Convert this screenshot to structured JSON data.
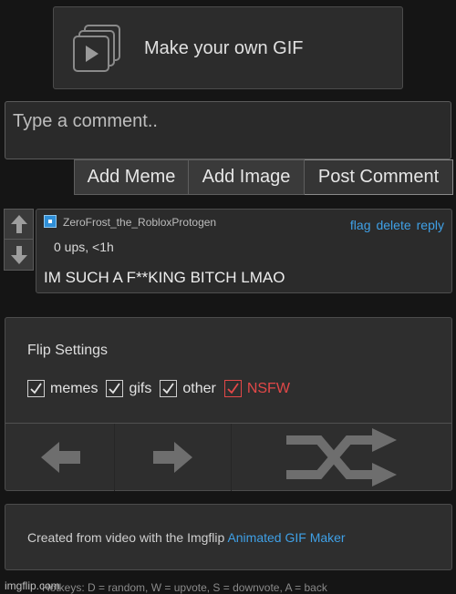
{
  "gif_button": {
    "label": "Make your own GIF",
    "icon": "gif-frames-icon"
  },
  "comment_input": {
    "placeholder": "Type a comment..",
    "value": ""
  },
  "buttons": {
    "add_meme": "Add Meme",
    "add_image": "Add Image",
    "post_comment": "Post Comment"
  },
  "comment": {
    "username": "ZeroFrost_the_RobloxProtogen",
    "avatar_color": "#2f8fd8",
    "actions": {
      "flag": "flag",
      "delete": "delete",
      "reply": "reply"
    },
    "meta": "0 ups, <1h",
    "text": "IM SUCH A F**KING BITCH LMAO"
  },
  "flip_settings": {
    "title": "Flip Settings",
    "filters": [
      {
        "label": "memes",
        "checked": true
      },
      {
        "label": "gifs",
        "checked": true
      },
      {
        "label": "other",
        "checked": true
      },
      {
        "label": "NSFW",
        "checked": true,
        "color": "#e24848"
      }
    ]
  },
  "info": {
    "text": "Created from video with the Imgflip ",
    "link": "Animated GIF Maker"
  },
  "hotkeys": "Hotkeys: D = random, W = upvote, S = downvote, A = back",
  "watermark": "imgflip.com",
  "colors": {
    "link": "#3fa0e6",
    "nsfw": "#e24848",
    "background": "#151515"
  }
}
